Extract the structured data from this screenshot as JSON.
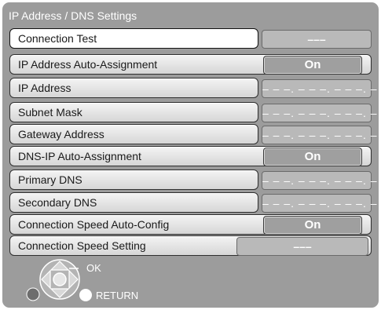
{
  "title": "IP Address / DNS Settings",
  "rows": [
    {
      "label": "Connection Test",
      "value": "–––"
    },
    {
      "label": "IP Address Auto-Assignment",
      "value": "On"
    },
    {
      "label": "IP Address",
      "value": "– – –. – – –. – – –. – – –"
    },
    {
      "label": "Subnet Mask",
      "value": "– – –. – – –. – – –. – – –"
    },
    {
      "label": "Gateway Address",
      "value": "– – –. – – –. – – –. – – –"
    },
    {
      "label": "DNS-IP Auto-Assignment",
      "value": "On"
    },
    {
      "label": "Primary DNS",
      "value": "– – –. – – –. – – –. – – –"
    },
    {
      "label": "Secondary DNS",
      "value": "– – –. – – –. – – –. – – –"
    },
    {
      "label": "Connection Speed Auto-Config",
      "value": "On"
    },
    {
      "label": "Connection Speed Setting",
      "value": "–––"
    }
  ],
  "nav": {
    "ok_label": "OK",
    "return_label": "RETURN"
  }
}
